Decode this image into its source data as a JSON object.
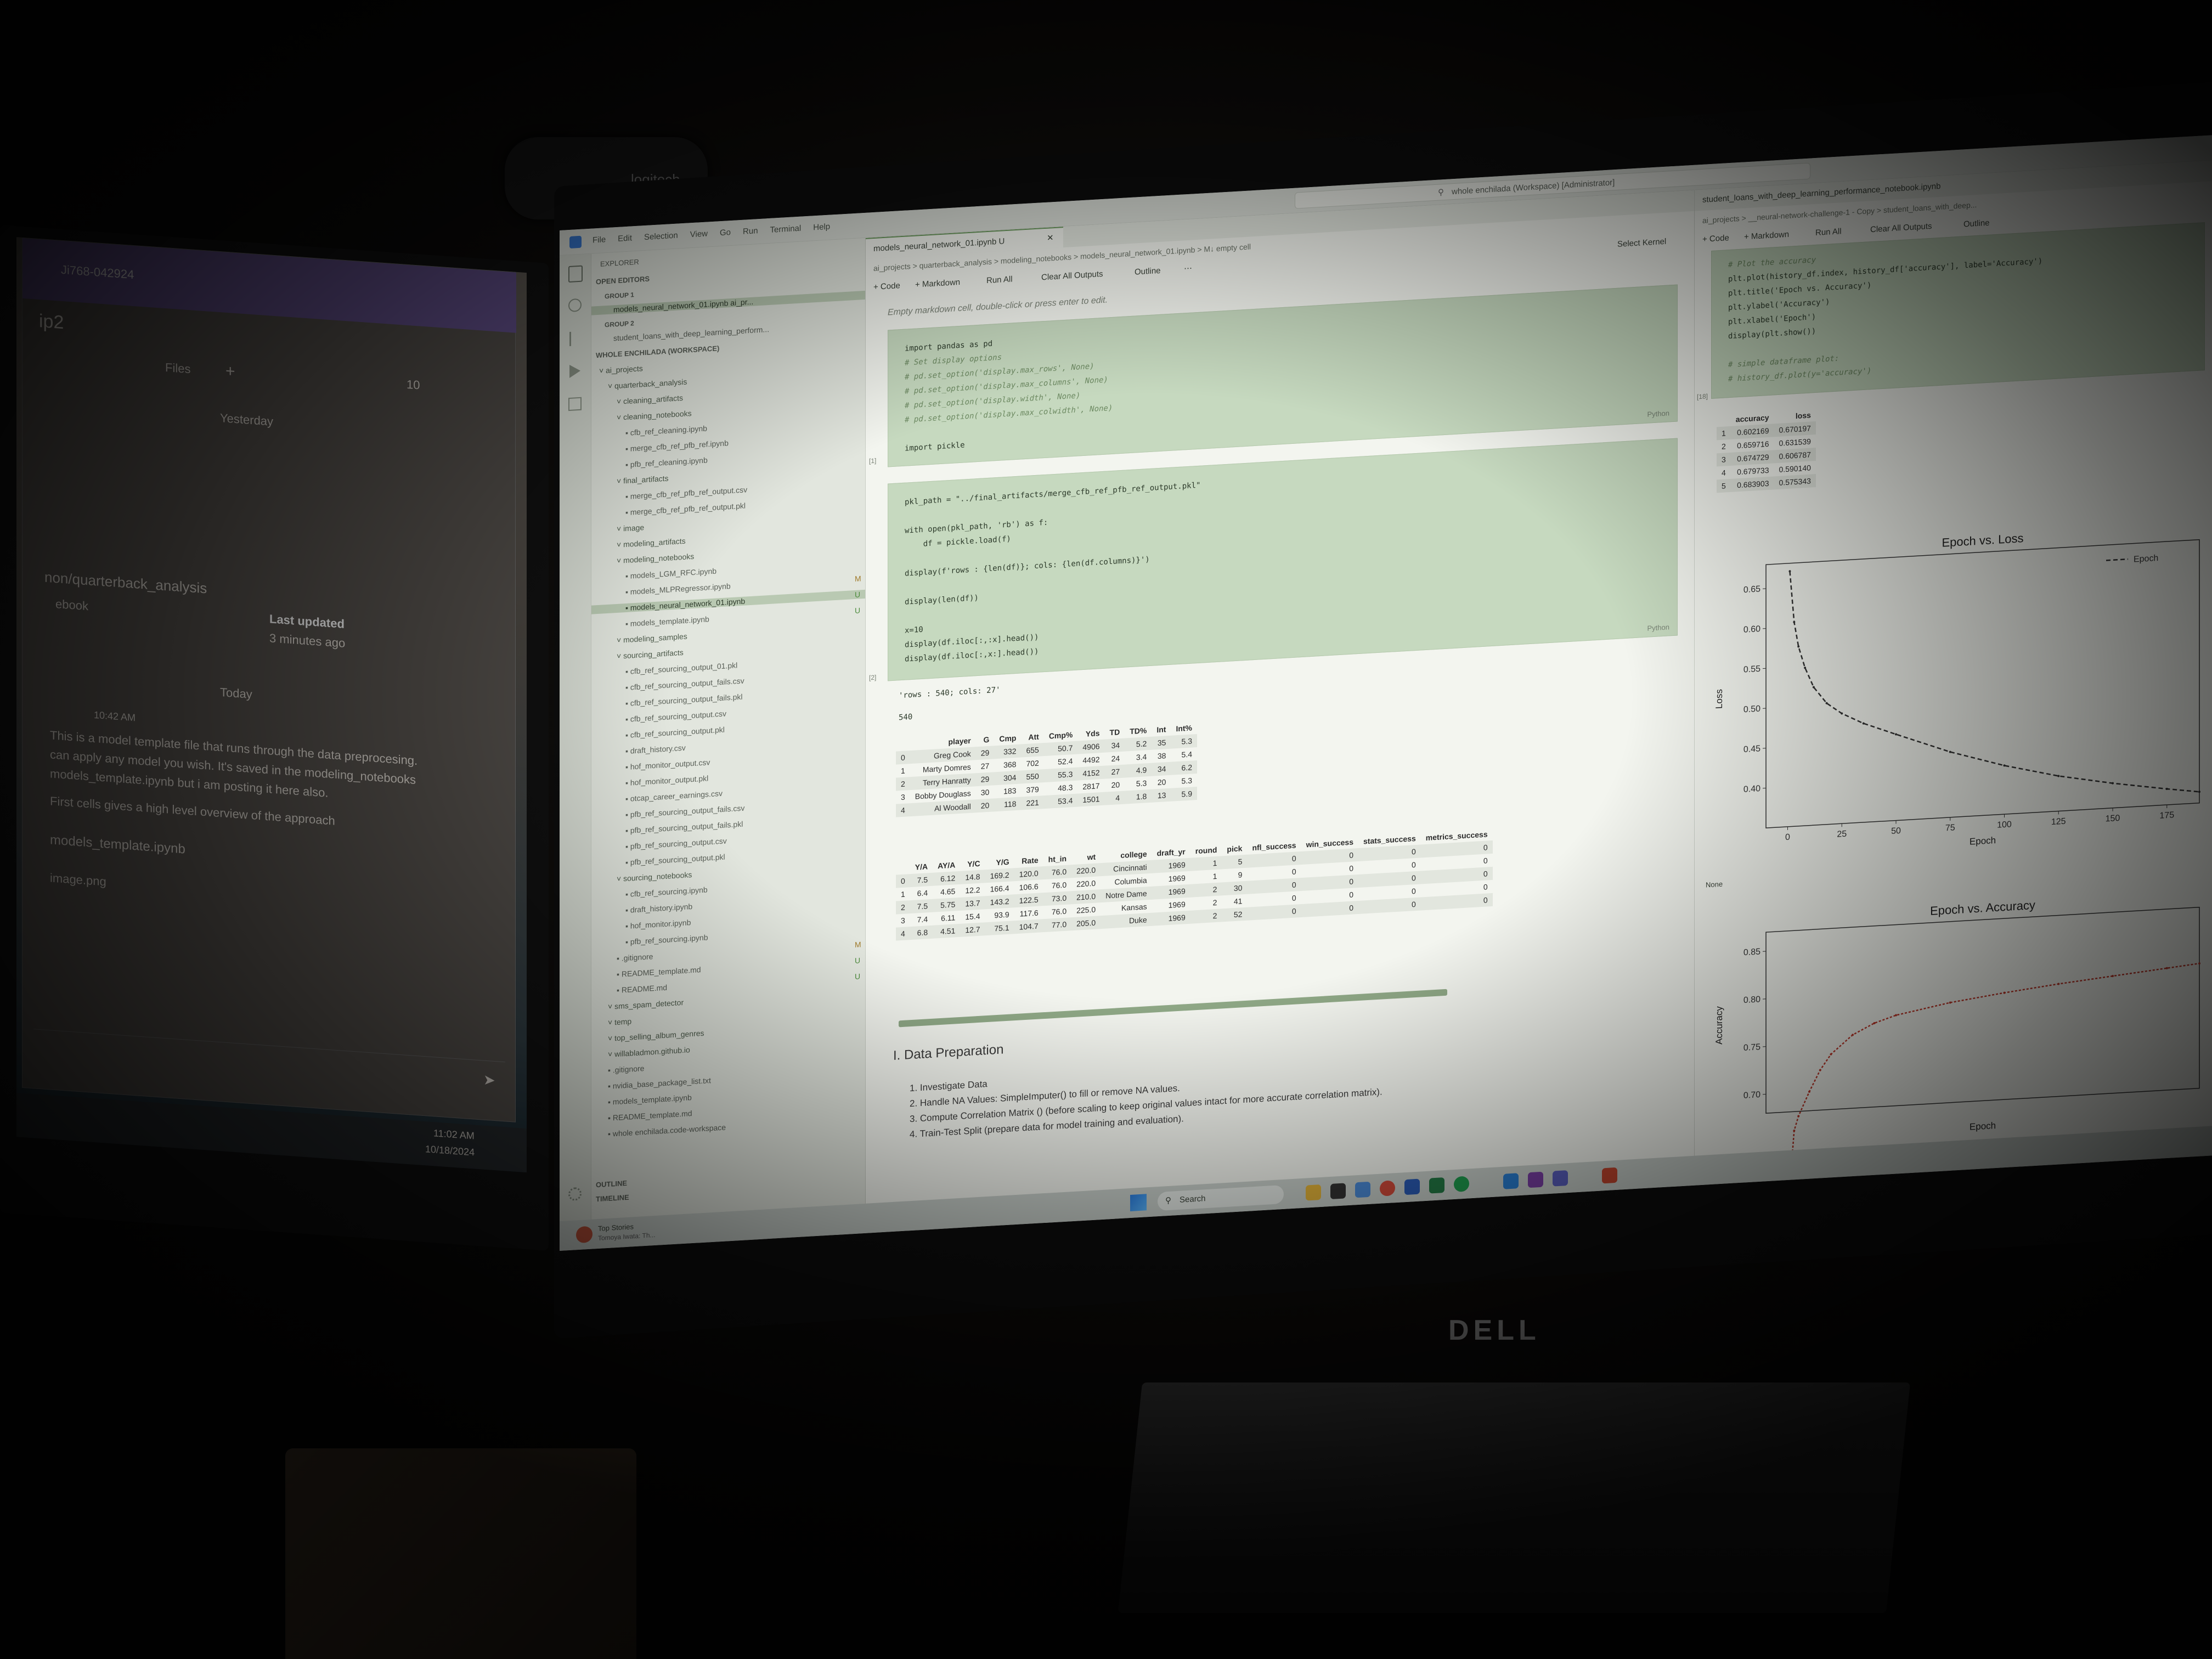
{
  "left_window": {
    "top_text": "Ji768-042924",
    "group": "ip2",
    "files_tab": "Files",
    "count": "10",
    "yesterday": "Yesterday",
    "channel": "non/quarterback_analysis",
    "last_updated_label": "Last updated",
    "last_updated_value": "3 minutes ago",
    "nbook": "ebook",
    "today": "Today",
    "msg_time": "10:42 AM",
    "msg_line1": "This is a model template file that runs through the data preprocesing.",
    "msg_line2": "can apply any model you wish. It's saved in the modeling_notebooks",
    "msg_line3": "models_template.ipynb  but i am posting it here also.",
    "msg_line4": "First cells gives a high level overview of the approach",
    "attachment": "models_template.ipynb",
    "image": "image.png",
    "clock_time": "11:02 AM",
    "clock_date": "10/18/2024"
  },
  "webcam_brand": "logitech",
  "monitor_brand": "DELL",
  "vscode": {
    "menu": [
      "File",
      "Edit",
      "Selection",
      "View",
      "Go",
      "Run",
      "Terminal",
      "Help"
    ],
    "search": "whole enchilada (Workspace) [Administrator]",
    "explorer_title": "EXPLORER",
    "open_editors": "OPEN EDITORS",
    "group1": "GROUP 1",
    "group1_file": "models_neural_network_01.ipynb  ai_pr...",
    "group2": "GROUP 2",
    "group2_file": "student_loans_with_deep_learning_perform...",
    "workspace": "WHOLE ENCHILADA (WORKSPACE)",
    "tree": [
      {
        "name": "ai_projects",
        "depth": 0,
        "dir": true
      },
      {
        "name": "quarterback_analysis",
        "depth": 1,
        "dir": true
      },
      {
        "name": "cleaning_artifacts",
        "depth": 2,
        "dir": true
      },
      {
        "name": "cleaning_notebooks",
        "depth": 2,
        "dir": true
      },
      {
        "name": "cfb_ref_cleaning.ipynb",
        "depth": 3
      },
      {
        "name": "merge_cfb_ref_pfb_ref.ipynb",
        "depth": 3
      },
      {
        "name": "pfb_ref_cleaning.ipynb",
        "depth": 3
      },
      {
        "name": "final_artifacts",
        "depth": 2,
        "dir": true
      },
      {
        "name": "merge_cfb_ref_pfb_ref_output.csv",
        "depth": 3
      },
      {
        "name": "merge_cfb_ref_pfb_ref_output.pkl",
        "depth": 3
      },
      {
        "name": "image",
        "depth": 2,
        "dir": true
      },
      {
        "name": "modeling_artifacts",
        "depth": 2,
        "dir": true
      },
      {
        "name": "modeling_notebooks",
        "depth": 2,
        "dir": true
      },
      {
        "name": "models_LGM_RFC.ipynb",
        "depth": 3
      },
      {
        "name": "models_MLPRegressor.ipynb",
        "depth": 3,
        "badge": "M"
      },
      {
        "name": "models_neural_network_01.ipynb",
        "depth": 3,
        "badge": "U",
        "selected": true
      },
      {
        "name": "models_template.ipynb",
        "depth": 3,
        "badge": "U"
      },
      {
        "name": "modeling_samples",
        "depth": 2,
        "dir": true
      },
      {
        "name": "sourcing_artifacts",
        "depth": 2,
        "dir": true
      },
      {
        "name": "cfb_ref_sourcing_output_01.pkl",
        "depth": 3
      },
      {
        "name": "cfb_ref_sourcing_output_fails.csv",
        "depth": 3
      },
      {
        "name": "cfb_ref_sourcing_output_fails.pkl",
        "depth": 3
      },
      {
        "name": "cfb_ref_sourcing_output.csv",
        "depth": 3
      },
      {
        "name": "cfb_ref_sourcing_output.pkl",
        "depth": 3
      },
      {
        "name": "draft_history.csv",
        "depth": 3
      },
      {
        "name": "hof_monitor_output.csv",
        "depth": 3
      },
      {
        "name": "hof_monitor_output.pkl",
        "depth": 3
      },
      {
        "name": "otcap_career_earnings.csv",
        "depth": 3
      },
      {
        "name": "pfb_ref_sourcing_output_fails.csv",
        "depth": 3
      },
      {
        "name": "pfb_ref_sourcing_output_fails.pkl",
        "depth": 3
      },
      {
        "name": "pfb_ref_sourcing_output.csv",
        "depth": 3
      },
      {
        "name": "pfb_ref_sourcing_output.pkl",
        "depth": 3
      },
      {
        "name": "sourcing_notebooks",
        "depth": 2,
        "dir": true
      },
      {
        "name": "cfb_ref_sourcing.ipynb",
        "depth": 3
      },
      {
        "name": "draft_history.ipynb",
        "depth": 3
      },
      {
        "name": "hof_monitor.ipynb",
        "depth": 3
      },
      {
        "name": "pfb_ref_sourcing.ipynb",
        "depth": 3
      },
      {
        "name": ".gitignore",
        "depth": 2,
        "badge": "M"
      },
      {
        "name": "README_template.md",
        "depth": 2,
        "badge": "U"
      },
      {
        "name": "README.md",
        "depth": 2,
        "badge": "U"
      },
      {
        "name": "sms_spam_detector",
        "depth": 1,
        "dir": true
      },
      {
        "name": "temp",
        "depth": 1,
        "dir": true
      },
      {
        "name": "top_selling_album_genres",
        "depth": 1,
        "dir": true
      },
      {
        "name": "willabladmon.github.io",
        "depth": 1,
        "dir": true
      },
      {
        "name": ".gitignore",
        "depth": 1
      },
      {
        "name": "nvidia_base_package_list.txt",
        "depth": 1
      },
      {
        "name": "models_template.ipynb",
        "depth": 1
      },
      {
        "name": "README_template.md",
        "depth": 1
      },
      {
        "name": "whole enchilada.code-workspace",
        "depth": 1
      }
    ],
    "outline": "OUTLINE",
    "timeline": "TIMELINE",
    "tab_label": "models_neural_network_01.ipynb U",
    "breadcrumb": "ai_projects > quarterback_analysis > modeling_notebooks > models_neural_network_01.ipynb > M↓ empty cell",
    "toolbar": {
      "code": "+ Code",
      "markdown": "+ Markdown",
      "run_all": "Run All",
      "clear": "Clear All Outputs",
      "outline": "Outline",
      "kernel": "Select Kernel"
    },
    "empty_md": "Empty markdown cell, double-click or press enter to edit.",
    "cell1": [
      "import pandas as pd",
      "# Set display options",
      "# pd.set_option('display.max_rows', None)",
      "# pd.set_option('display.max_columns', None)",
      "# pd.set_option('display.width', None)",
      "# pd.set_option('display.max_colwidth', None)",
      "",
      "import pickle"
    ],
    "cell1_num": "[1]",
    "cell2": [
      "pkl_path = \"../final_artifacts/merge_cfb_ref_pfb_ref_output.pkl\"",
      "",
      "with open(pkl_path, 'rb') as f:",
      "    df = pickle.load(f)",
      "",
      "display(f'rows : {len(df)}; cols: {len(df.columns)}')",
      "",
      "display(len(df))",
      "",
      "x=10",
      "display(df.iloc[:,:x].head())",
      "display(df.iloc[:,x:].head())"
    ],
    "cell2_num": "[2]",
    "lang": "Python",
    "out1": "'rows : 540; cols: 27'",
    "out2": "540",
    "table1": {
      "headers": [
        "",
        "player",
        "G",
        "Cmp",
        "Att",
        "Cmp%",
        "Yds",
        "TD",
        "TD%",
        "Int",
        "Int%"
      ],
      "rows": [
        [
          "0",
          "Greg Cook",
          "29",
          "332",
          "655",
          "50.7",
          "4906",
          "34",
          "5.2",
          "35",
          "5.3"
        ],
        [
          "1",
          "Marty Domres",
          "27",
          "368",
          "702",
          "52.4",
          "4492",
          "24",
          "3.4",
          "38",
          "5.4"
        ],
        [
          "2",
          "Terry Hanratty",
          "29",
          "304",
          "550",
          "55.3",
          "4152",
          "27",
          "4.9",
          "34",
          "6.2"
        ],
        [
          "3",
          "Bobby Douglass",
          "30",
          "183",
          "379",
          "48.3",
          "2817",
          "20",
          "5.3",
          "20",
          "5.3"
        ],
        [
          "4",
          "Al Woodall",
          "20",
          "118",
          "221",
          "53.4",
          "1501",
          "4",
          "1.8",
          "13",
          "5.9"
        ]
      ]
    },
    "table2": {
      "headers": [
        "",
        "Y/A",
        "AY/A",
        "Y/C",
        "Y/G",
        "Rate",
        "ht_in",
        "wt",
        "college",
        "draft_yr",
        "round",
        "pick",
        "nfl_success",
        "win_success",
        "stats_success",
        "metrics_success"
      ],
      "rows": [
        [
          "0",
          "7.5",
          "6.12",
          "14.8",
          "169.2",
          "120.0",
          "76.0",
          "220.0",
          "Cincinnati",
          "1969",
          "1",
          "5",
          "0",
          "0",
          "0",
          "0"
        ],
        [
          "1",
          "6.4",
          "4.65",
          "12.2",
          "166.4",
          "106.6",
          "76.0",
          "220.0",
          "Columbia",
          "1969",
          "1",
          "9",
          "0",
          "0",
          "0",
          "0"
        ],
        [
          "2",
          "7.5",
          "5.75",
          "13.7",
          "143.2",
          "122.5",
          "73.0",
          "210.0",
          "Notre Dame",
          "1969",
          "2",
          "30",
          "0",
          "0",
          "0",
          "0"
        ],
        [
          "3",
          "7.4",
          "6.11",
          "15.4",
          "93.9",
          "117.6",
          "76.0",
          "225.0",
          "Kansas",
          "1969",
          "2",
          "41",
          "0",
          "0",
          "0",
          "0"
        ],
        [
          "4",
          "6.8",
          "4.51",
          "12.7",
          "75.1",
          "104.7",
          "77.0",
          "205.0",
          "Duke",
          "1969",
          "2",
          "52",
          "0",
          "0",
          "0",
          "0"
        ]
      ]
    },
    "md_heading": "I. Data Preparation",
    "md_list": [
      "1. Investigate Data",
      "2. Handle NA Values: SimpleImputer() to fill or remove NA values.",
      "3. Compute Correlation Matrix () (before scaling to keep original values intact for more accurate correlation matrix).",
      "4. Train-Test Split (prepare data for model training and evaluation)."
    ],
    "right": {
      "tab": "student_loans_with_deep_learning_performance_notebook.ipynb",
      "breadcrumb": "ai_projects > __neural-network-challenge-1 - Copy > student_loans_with_deep...",
      "toolbar": {
        "code": "+ Code",
        "markdown": "+ Markdown",
        "run_all": "Run All",
        "clear": "Clear All Outputs",
        "outline": "Outline"
      },
      "code": [
        "# Plot the accuracy",
        "plt.plot(history_df.index, history_df['accuracy'], label='Accuracy')",
        "plt.title('Epoch vs. Accuracy')",
        "plt.ylabel('Accuracy')",
        "plt.xlabel('Epoch')",
        "display(plt.show())",
        "",
        "# simple dataframe plot:",
        "# history_df.plot(y='accuracy')"
      ],
      "cell_num": "[18]",
      "hist_headers": [
        "",
        "accuracy",
        "loss"
      ],
      "hist_rows": [
        [
          "1",
          "0.602169",
          "0.670197"
        ],
        [
          "2",
          "0.659716",
          "0.631539"
        ],
        [
          "3",
          "0.674729",
          "0.606787"
        ],
        [
          "4",
          "0.679733",
          "0.590140"
        ],
        [
          "5",
          "0.683903",
          "0.575343"
        ]
      ],
      "none_out": "None"
    },
    "taskbar_search": "Search",
    "news": "Top Stories",
    "news_sub": "Tomoya Iwata: Th..."
  },
  "chart_data": [
    {
      "type": "line",
      "title": "Epoch vs. Loss",
      "xlabel": "Epoch",
      "ylabel": "Loss",
      "xlim": [
        -10,
        190
      ],
      "ylim": [
        0.35,
        0.68
      ],
      "xticks": [
        0,
        25,
        50,
        75,
        100,
        125,
        150,
        175
      ],
      "yticks": [
        0.4,
        0.45,
        0.5,
        0.55,
        0.6,
        0.65
      ],
      "legend": "Epoch",
      "x": [
        1,
        3,
        5,
        8,
        12,
        18,
        25,
        35,
        50,
        75,
        100,
        125,
        150,
        175,
        190
      ],
      "y": [
        0.67,
        0.606,
        0.575,
        0.548,
        0.523,
        0.502,
        0.488,
        0.474,
        0.458,
        0.432,
        0.411,
        0.394,
        0.381,
        0.37,
        0.364
      ]
    },
    {
      "type": "line",
      "title": "Epoch vs. Accuracy",
      "xlabel": "Epoch",
      "ylabel": "Accuracy",
      "xlim": [
        -10,
        190
      ],
      "ylim": [
        0.68,
        0.87
      ],
      "yticks": [
        0.7,
        0.75,
        0.8,
        0.85
      ],
      "x": [
        1,
        3,
        5,
        10,
        15,
        20,
        30,
        40,
        50,
        75,
        100,
        125,
        150,
        175,
        190
      ],
      "y": [
        0.602,
        0.66,
        0.675,
        0.7,
        0.722,
        0.738,
        0.757,
        0.768,
        0.775,
        0.785,
        0.792,
        0.798,
        0.803,
        0.808,
        0.811
      ]
    }
  ]
}
